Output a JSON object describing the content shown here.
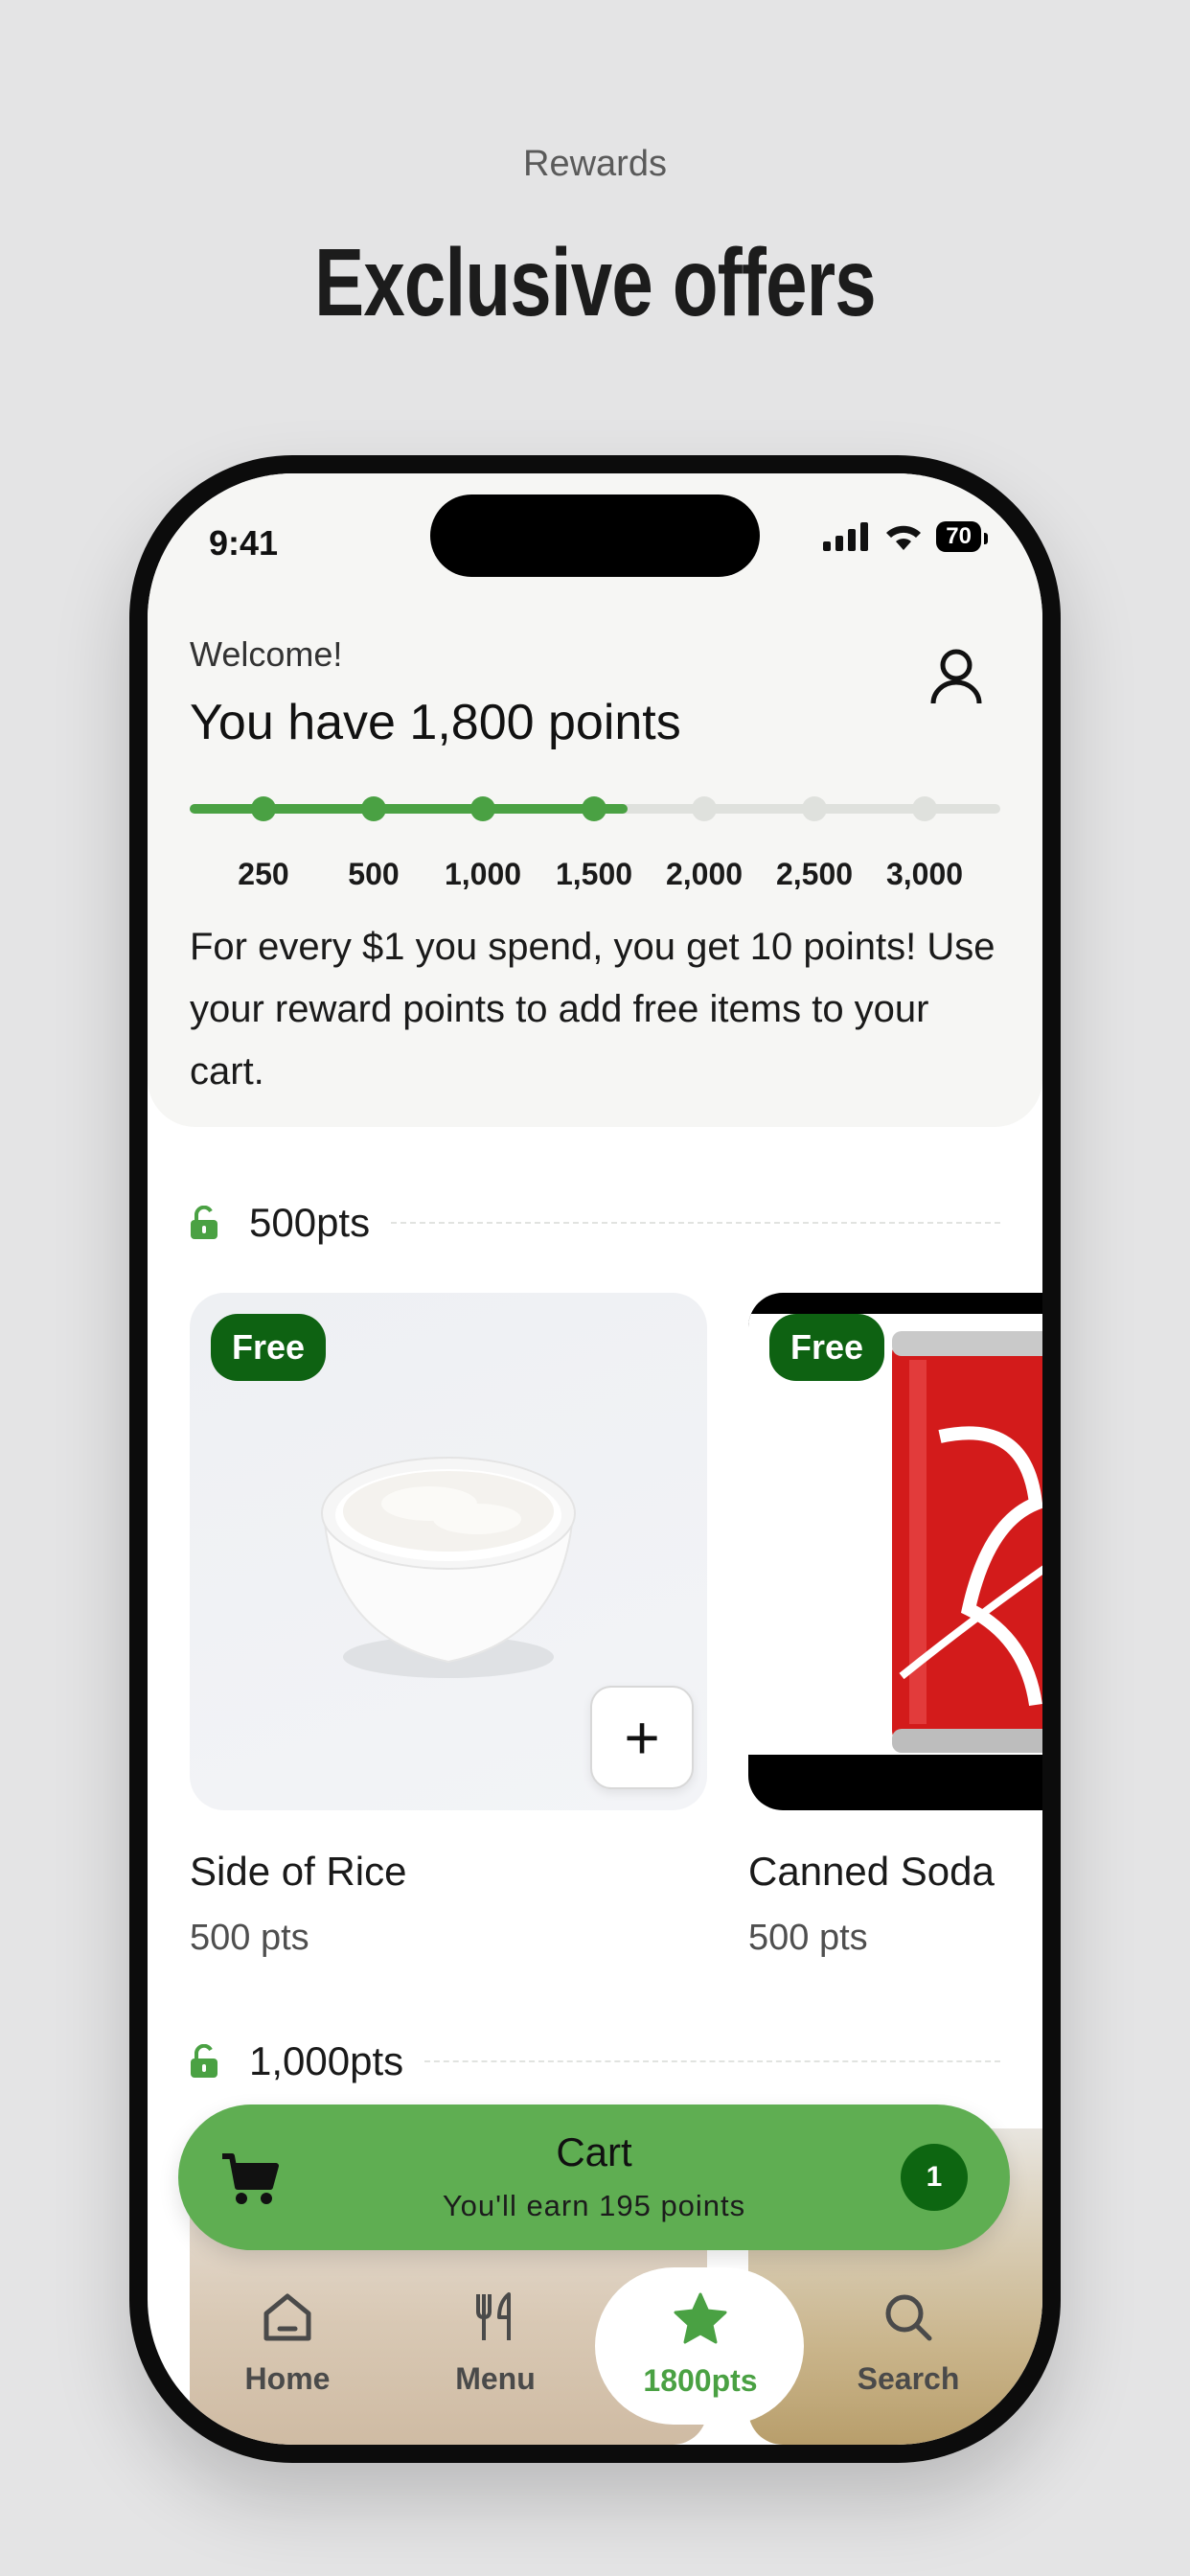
{
  "marketing": {
    "subtitle": "Rewards",
    "title": "Exclusive offers"
  },
  "status": {
    "time": "9:41",
    "battery": "70"
  },
  "header": {
    "welcome": "Welcome!",
    "points_title": "You have 1,800 points",
    "progress_fraction": 0.54,
    "milestones": [
      "250",
      "500",
      "1,000",
      "1,500",
      "2,000",
      "2,500",
      "3,000"
    ],
    "description": "For every $1 you spend, you get 10 points! Use your reward points to add free items to your cart."
  },
  "sections": [
    {
      "label": "500pts"
    },
    {
      "label": "1,000pts"
    }
  ],
  "items": [
    {
      "badge": "Free",
      "name": "Side of Rice",
      "cost": "500 pts"
    },
    {
      "badge": "Free",
      "name": "Canned Soda",
      "cost": "500 pts"
    }
  ],
  "cart": {
    "title": "Cart",
    "subtitle": "You'll earn 195 points",
    "count": "1"
  },
  "tabs": [
    {
      "label": "Home",
      "icon": "home-icon"
    },
    {
      "label": "Menu",
      "icon": "fork-knife-icon"
    },
    {
      "label": "1800pts",
      "icon": "star-icon"
    },
    {
      "label": "Search",
      "icon": "search-icon"
    }
  ],
  "colors": {
    "accent": "#4aa143",
    "badge": "#0e6212",
    "cart": "#5fae52"
  }
}
